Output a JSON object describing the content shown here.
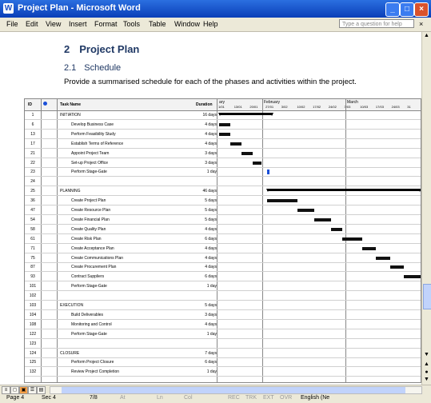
{
  "window": {
    "title": "Project Plan - Microsoft Word",
    "app_icon": "word-icon"
  },
  "menu": {
    "items": [
      "File",
      "Edit",
      "View",
      "Insert",
      "Format",
      "Tools",
      "Table",
      "Window",
      "Help"
    ],
    "help_placeholder": "Type a question for help"
  },
  "doc": {
    "h1_num": "2",
    "h1_text": "Project Plan",
    "h2_num": "2.1",
    "h2_text": "Schedule",
    "intro": "Provide a summarised schedule for each of the phases and activities within the project."
  },
  "gantt": {
    "headers": {
      "id": "ID",
      "task": "Task Name",
      "duration": "Duration"
    },
    "months": [
      "ary",
      "February",
      "March"
    ],
    "weeks": [
      "1/01",
      "13/01",
      "20/01",
      "27/01",
      "3/02",
      "10/02",
      "17/02",
      "24/02",
      "3/03",
      "10/03",
      "17/03",
      "24/03",
      "31"
    ],
    "rows": [
      {
        "id": "1",
        "name": "INITIATION",
        "dur": "16 days",
        "indent": 0,
        "kind": "summary",
        "s": 0,
        "e": 19
      },
      {
        "id": "6",
        "name": "Develop Business Case",
        "dur": "4 days",
        "indent": 1,
        "kind": "task",
        "s": 0,
        "e": 4
      },
      {
        "id": "13",
        "name": "Perform Feasibility Study",
        "dur": "4 days",
        "indent": 1,
        "kind": "task",
        "s": 0,
        "e": 4
      },
      {
        "id": "17",
        "name": "Establish Terms of Reference",
        "dur": "4 days",
        "indent": 1,
        "kind": "task",
        "s": 4,
        "e": 8
      },
      {
        "id": "21",
        "name": "Appoint Project Team",
        "dur": "3 days",
        "indent": 1,
        "kind": "task",
        "s": 8,
        "e": 12
      },
      {
        "id": "22",
        "name": "Set-up Project Office",
        "dur": "3 days",
        "indent": 1,
        "kind": "task",
        "s": 12,
        "e": 15
      },
      {
        "id": "23",
        "name": "Perform Stage-Gate",
        "dur": "1 day",
        "indent": 1,
        "kind": "milestone",
        "s": 17,
        "e": 18
      },
      {
        "id": "24",
        "name": "",
        "dur": "",
        "indent": 0,
        "kind": "none",
        "s": 0,
        "e": 0
      },
      {
        "id": "25",
        "name": "PLANNING",
        "dur": "46 days",
        "indent": 0,
        "kind": "summary",
        "s": 17,
        "e": 72
      },
      {
        "id": "36",
        "name": "Create Project Plan",
        "dur": "5 days",
        "indent": 1,
        "kind": "task",
        "s": 17,
        "e": 28
      },
      {
        "id": "47",
        "name": "Create Resource Plan",
        "dur": "5 days",
        "indent": 1,
        "kind": "task",
        "s": 28,
        "e": 34
      },
      {
        "id": "54",
        "name": "Create Financial Plan",
        "dur": "5 days",
        "indent": 1,
        "kind": "task",
        "s": 34,
        "e": 40
      },
      {
        "id": "58",
        "name": "Create Quality Plan",
        "dur": "4 days",
        "indent": 1,
        "kind": "task",
        "s": 40,
        "e": 44
      },
      {
        "id": "61",
        "name": "Create Risk Plan",
        "dur": "6 days",
        "indent": 1,
        "kind": "task",
        "s": 44,
        "e": 51
      },
      {
        "id": "71",
        "name": "Create Acceptance Plan",
        "dur": "4 days",
        "indent": 1,
        "kind": "task",
        "s": 51,
        "e": 56
      },
      {
        "id": "75",
        "name": "Create Communications Plan",
        "dur": "4 days",
        "indent": 1,
        "kind": "task",
        "s": 56,
        "e": 61
      },
      {
        "id": "87",
        "name": "Create Procurement Plan",
        "dur": "4 days",
        "indent": 1,
        "kind": "task",
        "s": 61,
        "e": 66
      },
      {
        "id": "93",
        "name": "Contract Suppliers",
        "dur": "6 days",
        "indent": 1,
        "kind": "task",
        "s": 66,
        "e": 72
      },
      {
        "id": "101",
        "name": "Perform Stage-Gate",
        "dur": "1 day",
        "indent": 1,
        "kind": "milestone",
        "s": 72,
        "e": 73
      },
      {
        "id": "102",
        "name": "",
        "dur": "",
        "indent": 0,
        "kind": "none",
        "s": 0,
        "e": 0
      },
      {
        "id": "103",
        "name": "EXECUTION",
        "dur": "5 days",
        "indent": 0,
        "kind": "milestone",
        "s": 72,
        "e": 73
      },
      {
        "id": "104",
        "name": "Build Deliverables",
        "dur": "3 days",
        "indent": 1,
        "kind": "milestone",
        "s": 72,
        "e": 73
      },
      {
        "id": "108",
        "name": "Monitoring and Control",
        "dur": "4 days",
        "indent": 1,
        "kind": "milestone",
        "s": 72,
        "e": 73
      },
      {
        "id": "122",
        "name": "Perform Stage-Gate",
        "dur": "1 day",
        "indent": 1,
        "kind": "none",
        "s": 0,
        "e": 0
      },
      {
        "id": "123",
        "name": "",
        "dur": "",
        "indent": 0,
        "kind": "none",
        "s": 0,
        "e": 0
      },
      {
        "id": "124",
        "name": "CLOSURE",
        "dur": "7 days",
        "indent": 0,
        "kind": "none",
        "s": 0,
        "e": 0
      },
      {
        "id": "125",
        "name": "Perform Project Closure",
        "dur": "6 days",
        "indent": 1,
        "kind": "none",
        "s": 0,
        "e": 0
      },
      {
        "id": "132",
        "name": "Review Project Completion",
        "dur": "1 day",
        "indent": 1,
        "kind": "none",
        "s": 0,
        "e": 0
      }
    ]
  },
  "status": {
    "page": "Page 4",
    "sec": "Sec 4",
    "pos": "7/8",
    "at": "At",
    "ln": "Ln",
    "col": "Col",
    "rec": "REC",
    "trk": "TRK",
    "ext": "EXT",
    "ovr": "OVR",
    "lang": "English (Ne"
  }
}
